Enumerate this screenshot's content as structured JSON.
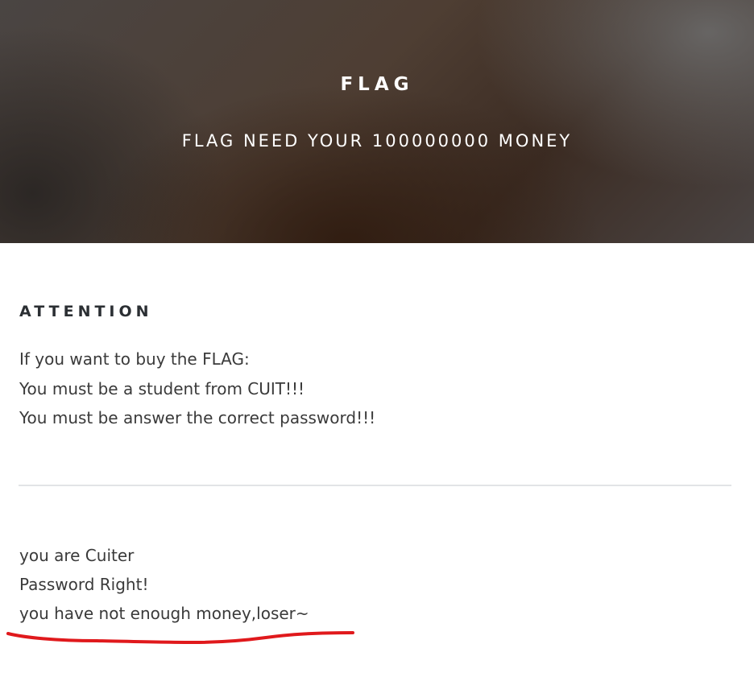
{
  "hero": {
    "title": "FLAG",
    "subtitle": "FLAG NEED YOUR 100000000 MONEY"
  },
  "attention": {
    "heading": "ATTENTION",
    "lines": [
      "If you want to buy the FLAG:",
      "You must be a student from CUIT!!!",
      "You must be answer the correct password!!!"
    ]
  },
  "result": {
    "lines": [
      "you are Cuiter",
      "Password Right!",
      "you have not enough money,loser~"
    ]
  },
  "annotation": {
    "underline_color": "#e0191c"
  }
}
